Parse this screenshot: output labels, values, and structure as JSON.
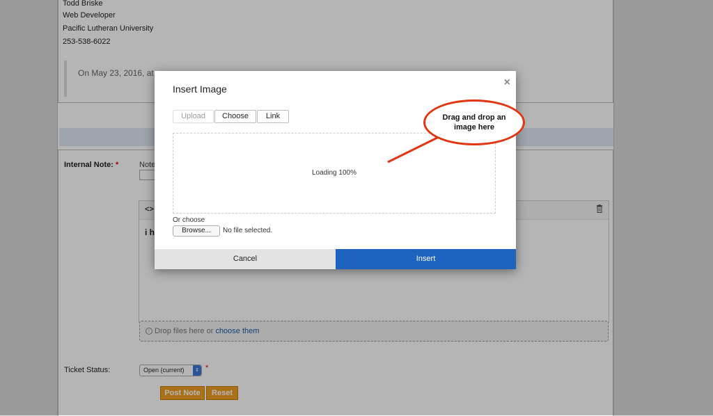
{
  "signature": {
    "name": "Todd Briske",
    "title": "Web Developer",
    "organization": "Pacific Lutheran University",
    "phone": "253-538-6022"
  },
  "quoted_text": "On May 23, 2016, at",
  "internal_note": {
    "label": "Internal Note:",
    "required_mark": "*",
    "note_title_label": "Note",
    "editor_text": "i ha",
    "dropzone_text": "Drop files here or ",
    "dropzone_link": "choose them"
  },
  "ticket_status": {
    "label": "Ticket Status:",
    "value": "Open (current)",
    "required_mark": "*"
  },
  "actions": {
    "post_note": "Post Note",
    "reset": "Reset"
  },
  "modal": {
    "title": "Insert Image",
    "close_glyph": "×",
    "tabs": [
      {
        "label": "Upload",
        "disabled": true
      },
      {
        "label": "Choose",
        "disabled": false
      },
      {
        "label": "Link",
        "disabled": false
      }
    ],
    "loading_text": "Loading 100%",
    "or_choose": "Or choose",
    "browse_label": "Browse...",
    "file_status": "No file selected.",
    "cancel_label": "Cancel",
    "insert_label": "Insert"
  },
  "callout": {
    "line1": "Drag and drop an",
    "line2": "image here"
  },
  "icons": {
    "close": "close-icon",
    "code": "code-icon",
    "trash": "trash-icon",
    "upload": "upload-icon",
    "select_arrow": "chevron-updown-icon"
  },
  "colors": {
    "accent_blue": "#1e64bf",
    "button_orange": "#f0a022",
    "callout_red": "#e3350f"
  }
}
